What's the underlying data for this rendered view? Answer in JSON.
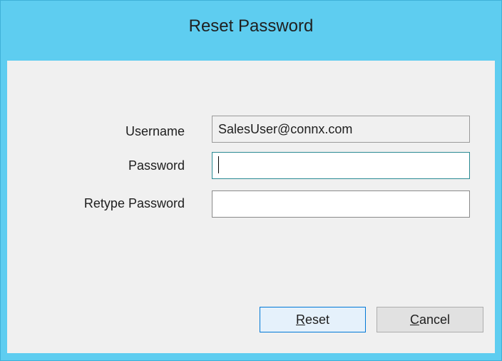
{
  "window": {
    "title": "Reset Password"
  },
  "form": {
    "username": {
      "label": "Username",
      "value": "SalesUser@connx.com"
    },
    "password": {
      "label": "Password",
      "value": ""
    },
    "retype_password": {
      "label": "Retype Password",
      "value": ""
    }
  },
  "buttons": {
    "reset": {
      "mnemonic": "R",
      "rest": "eset"
    },
    "cancel": {
      "mnemonic": "C",
      "rest": "ancel"
    }
  }
}
